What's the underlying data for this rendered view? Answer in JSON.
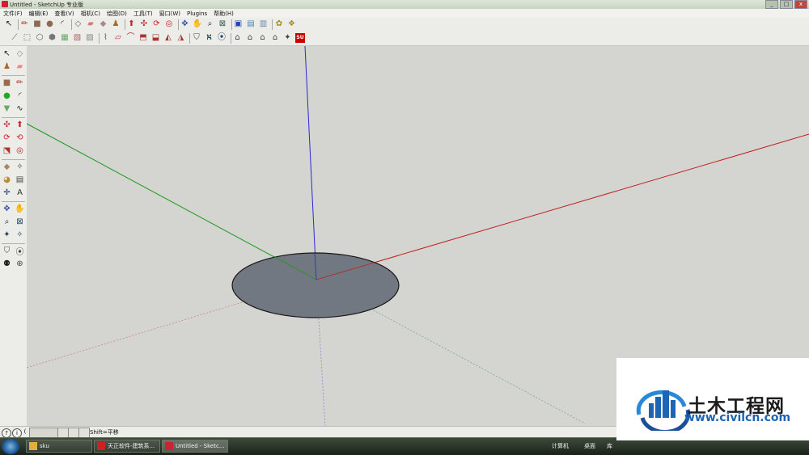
{
  "window": {
    "title": "Untitled - SketchUp 专业版",
    "controls": {
      "minimize": "_",
      "maximize": "□",
      "close": "x"
    }
  },
  "menu": [
    {
      "label": "文件(F)"
    },
    {
      "label": "编辑(E)"
    },
    {
      "label": "查看(V)"
    },
    {
      "label": "相机(C)"
    },
    {
      "label": "绘图(D)"
    },
    {
      "label": "工具(T)"
    },
    {
      "label": "窗口(W)"
    },
    {
      "label": "Plugins"
    },
    {
      "label": "帮助(H)"
    }
  ],
  "toolbar1": [
    {
      "name": "select-tool-icon",
      "glyph": "↖",
      "color": "#222"
    },
    {
      "name": "pencil-tool-icon",
      "glyph": "✏",
      "color": "#b02a1a"
    },
    {
      "name": "rectangle-tool-icon",
      "glyph": "■",
      "color": "#8a6a50"
    },
    {
      "name": "circle-tool-icon",
      "glyph": "●",
      "color": "#8a6a50"
    },
    {
      "name": "arc-tool-icon",
      "glyph": "◜",
      "color": "#222"
    },
    {
      "name": "make-component-icon",
      "glyph": "◇",
      "color": "#666"
    },
    {
      "name": "eraser-tool-icon",
      "glyph": "▰",
      "color": "#d77"
    },
    {
      "name": "tape-measure-icon",
      "glyph": "◆",
      "color": "#a88"
    },
    {
      "name": "paint-bucket-icon",
      "glyph": "♟",
      "color": "#a62"
    },
    {
      "name": "push-pull-icon",
      "glyph": "⬆",
      "color": "#c22"
    },
    {
      "name": "move-tool-icon",
      "glyph": "✣",
      "color": "#b22"
    },
    {
      "name": "rotate-tool-icon",
      "glyph": "⟳",
      "color": "#c22"
    },
    {
      "name": "offset-tool-icon",
      "glyph": "◎",
      "color": "#b22"
    },
    {
      "name": "orbit-tool-icon",
      "glyph": "✥",
      "color": "#35a"
    },
    {
      "name": "pan-tool-icon",
      "glyph": "✋",
      "color": "#444"
    },
    {
      "name": "zoom-tool-icon",
      "glyph": "⌕",
      "color": "#223"
    },
    {
      "name": "zoom-extents-icon",
      "glyph": "⊠",
      "color": "#355"
    },
    {
      "name": "get-models-icon",
      "glyph": "▣",
      "color": "#24a"
    },
    {
      "name": "share-model-icon",
      "glyph": "▤",
      "color": "#48a"
    },
    {
      "name": "share-component-icon",
      "glyph": "▥",
      "color": "#68a"
    },
    {
      "name": "get-photo-texture-icon",
      "glyph": "✿",
      "color": "#a82"
    },
    {
      "name": "component-options-icon",
      "glyph": "❖",
      "color": "#a82"
    }
  ],
  "toolbar2": [
    {
      "name": "section-plane-icon",
      "glyph": "⟋",
      "color": "#555"
    },
    {
      "name": "xray-style-icon",
      "glyph": "⬚",
      "color": "#555"
    },
    {
      "name": "wireframe-style-icon",
      "glyph": "⬡",
      "color": "#555"
    },
    {
      "name": "hidden-line-icon",
      "glyph": "⬢",
      "color": "#777"
    },
    {
      "name": "shaded-style-icon",
      "glyph": "▦",
      "color": "#6a6"
    },
    {
      "name": "textured-style-icon",
      "glyph": "▧",
      "color": "#a66"
    },
    {
      "name": "monochrome-style-icon",
      "glyph": "▨",
      "color": "#888"
    },
    {
      "name": "sandbox-contours-icon",
      "glyph": "⌇",
      "color": "#a33"
    },
    {
      "name": "sandbox-scratch-icon",
      "glyph": "▱",
      "color": "#a33"
    },
    {
      "name": "sandbox-smoove-icon",
      "glyph": "⌒",
      "color": "#a33"
    },
    {
      "name": "sandbox-stamp-icon",
      "glyph": "⬒",
      "color": "#a33"
    },
    {
      "name": "sandbox-drape-icon",
      "glyph": "⬓",
      "color": "#a33"
    },
    {
      "name": "sandbox-detail-icon",
      "glyph": "◭",
      "color": "#a33"
    },
    {
      "name": "sandbox-flip-icon",
      "glyph": "◮",
      "color": "#a33"
    },
    {
      "name": "position-camera-icon",
      "glyph": "⛉",
      "color": "#444"
    },
    {
      "name": "walk-tool-icon",
      "glyph": "⛕",
      "color": "#246"
    },
    {
      "name": "look-around-icon",
      "glyph": "⦿",
      "color": "#246"
    },
    {
      "name": "front-view-icon",
      "glyph": "⌂",
      "color": "#444"
    },
    {
      "name": "back-view-icon",
      "glyph": "⌂",
      "color": "#444"
    },
    {
      "name": "left-view-icon",
      "glyph": "⌂",
      "color": "#444"
    },
    {
      "name": "right-view-icon",
      "glyph": "⌂",
      "color": "#444"
    },
    {
      "name": "iso-view-icon",
      "glyph": "✦",
      "color": "#444"
    },
    {
      "name": "plugin-su-icon",
      "glyph": "SU",
      "color": "#c00"
    }
  ],
  "lefttools": [
    {
      "name": "select-tool-icon",
      "glyph": "↖",
      "color": "#222"
    },
    {
      "name": "make-component-icon",
      "glyph": "◇",
      "color": "#888"
    },
    {
      "name": "paint-bucket-icon",
      "glyph": "♟",
      "color": "#a62"
    },
    {
      "name": "eraser-tool-icon",
      "glyph": "▰",
      "color": "#e88"
    },
    {
      "name": "rectangle-tool-icon",
      "glyph": "■",
      "color": "#9a6a50"
    },
    {
      "name": "line-tool-icon",
      "glyph": "✏",
      "color": "#b02a1a"
    },
    {
      "name": "circle-tool-icon",
      "glyph": "●",
      "color": "#2a2"
    },
    {
      "name": "arc-tool-icon",
      "glyph": "◜",
      "color": "#222"
    },
    {
      "name": "polygon-tool-icon",
      "glyph": "▼",
      "color": "#6a6"
    },
    {
      "name": "freehand-tool-icon",
      "glyph": "∿",
      "color": "#222"
    },
    {
      "name": "move-tool-icon",
      "glyph": "✣",
      "color": "#b22"
    },
    {
      "name": "push-pull-icon",
      "glyph": "⬆",
      "color": "#c22"
    },
    {
      "name": "rotate-tool-icon",
      "glyph": "⟳",
      "color": "#c22"
    },
    {
      "name": "follow-me-icon",
      "glyph": "⟲",
      "color": "#c22"
    },
    {
      "name": "scale-tool-icon",
      "glyph": "⬔",
      "color": "#a33"
    },
    {
      "name": "offset-tool-icon",
      "glyph": "◎",
      "color": "#b22"
    },
    {
      "name": "tape-measure-icon",
      "glyph": "◆",
      "color": "#a86"
    },
    {
      "name": "dimension-tool-icon",
      "glyph": "✧",
      "color": "#444"
    },
    {
      "name": "protractor-tool-icon",
      "glyph": "◕",
      "color": "#b83"
    },
    {
      "name": "text-tool-icon",
      "glyph": "▤",
      "color": "#444"
    },
    {
      "name": "axes-tool-icon",
      "glyph": "✛",
      "color": "#236"
    },
    {
      "name": "3d-text-icon",
      "glyph": "A",
      "color": "#333"
    },
    {
      "name": "orbit-tool-icon",
      "glyph": "✥",
      "color": "#35a"
    },
    {
      "name": "pan-tool-icon",
      "glyph": "✋",
      "color": "#444"
    },
    {
      "name": "zoom-tool-icon",
      "glyph": "⌕",
      "color": "#223"
    },
    {
      "name": "zoom-window-icon",
      "glyph": "⊠",
      "color": "#246"
    },
    {
      "name": "zoom-extents-icon",
      "glyph": "✦",
      "color": "#246"
    },
    {
      "name": "previous-view-icon",
      "glyph": "✧",
      "color": "#246"
    },
    {
      "name": "position-camera-icon",
      "glyph": "⛉",
      "color": "#444"
    },
    {
      "name": "look-around-icon",
      "glyph": "⦿",
      "color": "#444"
    },
    {
      "name": "walk-tool-icon",
      "glyph": "⚉",
      "color": "#222"
    },
    {
      "name": "section-plane-icon",
      "glyph": "⊕",
      "color": "#444"
    }
  ],
  "status": {
    "text": "Shift=平移",
    "buttons": [
      "?",
      "i",
      "(",
      "",
      "",
      "",
      ""
    ]
  },
  "taskbar": {
    "tasks": [
      {
        "label": "sku",
        "icon": "#e0b040"
      },
      {
        "label": "天正软件-建筑系...",
        "icon": "#c22"
      },
      {
        "label": "Untitled - Sketc...",
        "icon": "#c23"
      }
    ],
    "tray_left": "计算机",
    "tray_mid": "桌面",
    "tray_right": "库"
  },
  "watermark": {
    "brand": "土木工程网",
    "url": "www.civilcn.com"
  },
  "colors": {
    "canvas_bg": "#d4d4d1",
    "axis_red": "#c02020",
    "axis_green": "#1a9a1a",
    "axis_blue": "#2020c0",
    "disc_fill": "#6e7680"
  }
}
